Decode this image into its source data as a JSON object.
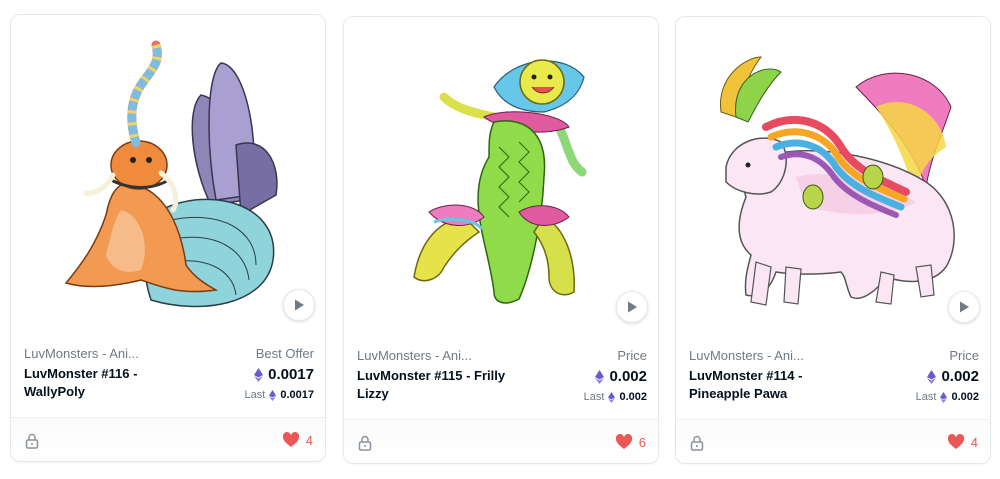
{
  "cards": [
    {
      "collection": "LuvMonsters - Ani...",
      "name": "LuvMonster #116 - WallyPoly",
      "price_label": "Best Offer",
      "price": "0.0017",
      "last_label": "Last",
      "last_price": "0.0017",
      "likes": "4"
    },
    {
      "collection": "LuvMonsters - Ani...",
      "name": "LuvMonster #115 - Frilly Lizzy",
      "price_label": "Price",
      "price": "0.002",
      "last_label": "Last",
      "last_price": "0.002",
      "likes": "6"
    },
    {
      "collection": "LuvMonsters - Ani...",
      "name": "LuvMonster #114 - Pineapple Pawa",
      "price_label": "Price",
      "price": "0.002",
      "last_label": "Last",
      "last_price": "0.002",
      "likes": "4"
    }
  ],
  "icons": {
    "currency": "ethereum-icon",
    "play": "play-icon",
    "lock": "lock-icon",
    "favorite": "heart-icon"
  },
  "colors": {
    "eth": "#6a5acd",
    "heart": "#eb5757",
    "muted": "#707a83",
    "text": "#04111d",
    "border": "#e5e8eb"
  }
}
